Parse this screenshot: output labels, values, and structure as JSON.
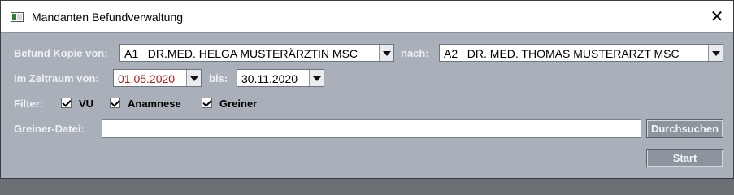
{
  "window": {
    "title": "Mandanten Befundverwaltung",
    "close_glyph": "✕"
  },
  "row_befund": {
    "label": "Befund Kopie von:",
    "from_value": "A1   DR.MED. HELGA MUSTERÄRZTIN MSC",
    "to_label": "nach:",
    "to_value": "A2   DR. MED. THOMAS MUSTERARZT MSC"
  },
  "row_zeitraum": {
    "label": "Im Zeitraum von:",
    "from_date": "01.05.2020",
    "to_label": "bis:",
    "to_date": "30.11.2020"
  },
  "filter": {
    "label": "Filter:",
    "options": [
      {
        "label": "VU",
        "checked": true
      },
      {
        "label": "Anamnese",
        "checked": true
      },
      {
        "label": "Greiner",
        "checked": true
      }
    ]
  },
  "greiner": {
    "label": "Greiner-Datei:",
    "value": "",
    "browse_label": "Durchsuchen"
  },
  "start_label": "Start",
  "colors": {
    "background": "#a9b0b9",
    "label": "#eef0f3",
    "date_red": "#b01818",
    "button": "#8c949e"
  },
  "icons": [
    "app-window-icon",
    "close-icon",
    "dropdown-arrow-icon",
    "checkbox-checked-icon"
  ]
}
